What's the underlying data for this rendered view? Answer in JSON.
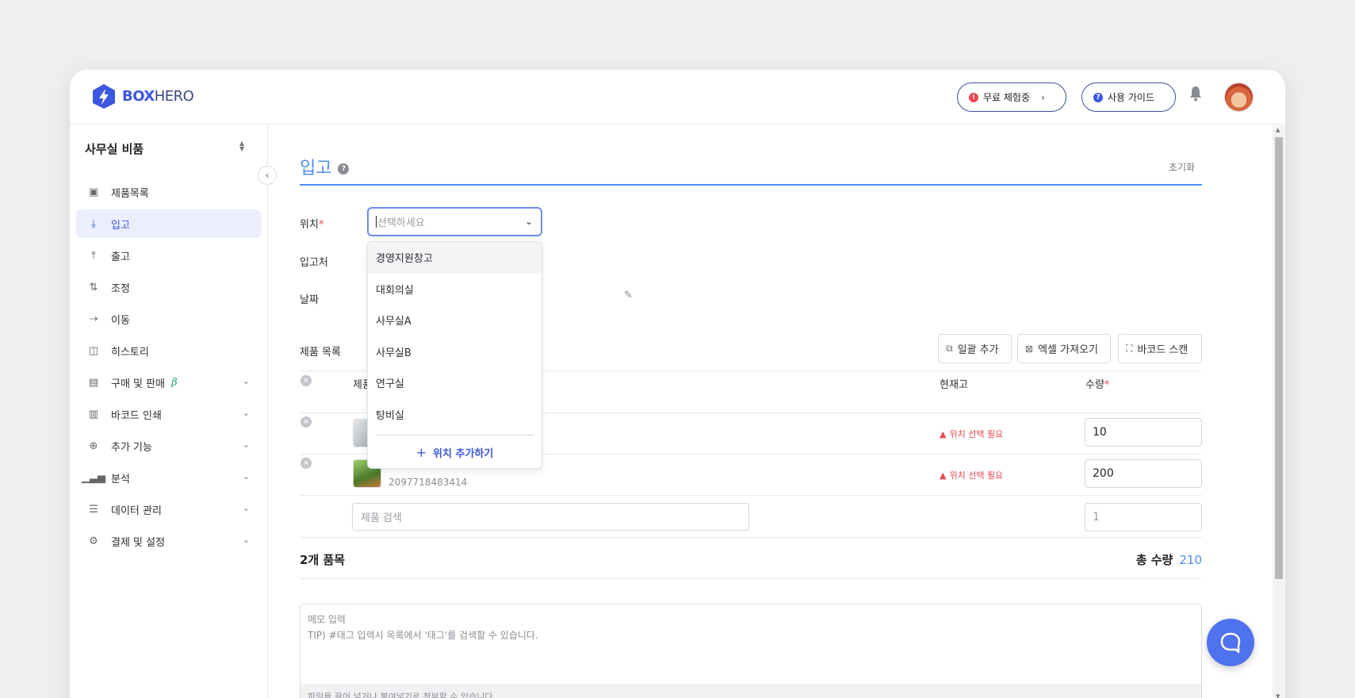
{
  "header": {
    "logo_text_bold": "BOX",
    "logo_text_rest": "HERO",
    "trial_label": "무료 체험중",
    "trial_badge": "!",
    "guide_label": "사용 가이드",
    "guide_badge": "?"
  },
  "sidebar": {
    "workspace": "사무실 비품",
    "items": [
      {
        "label": "제품목록",
        "icon": "box-icon"
      },
      {
        "label": "입고",
        "icon": "arrow-down-icon"
      },
      {
        "label": "출고",
        "icon": "arrow-up-icon"
      },
      {
        "label": "조정",
        "icon": "swap-vertical-icon"
      },
      {
        "label": "이동",
        "icon": "arrow-right-icon"
      },
      {
        "label": "히스토리",
        "icon": "history-icon"
      },
      {
        "label": "구매 및 판매",
        "icon": "document-icon",
        "badge": "β"
      },
      {
        "label": "바코드 인쇄",
        "icon": "barcode-icon"
      },
      {
        "label": "추가 기능",
        "icon": "plus-circle-icon"
      },
      {
        "label": "분석",
        "icon": "bar-chart-icon"
      },
      {
        "label": "데이터 관리",
        "icon": "database-icon"
      },
      {
        "label": "결제 및 설정",
        "icon": "gear-icon"
      }
    ]
  },
  "main": {
    "title": "입고",
    "help_badge": "?",
    "reset_label": "초기화",
    "location_label": "위치",
    "required_mark": "*",
    "location_placeholder": "선택하세요",
    "supplier_label": "입고처",
    "date_label": "날짜",
    "dropdown": {
      "options": [
        "경영지원창고",
        "대회의실",
        "사무실A",
        "사무실B",
        "연구실",
        "탕비실"
      ],
      "add_label": "위치 추가하기"
    },
    "products_label": "제품 목록",
    "toolbar": {
      "bulk_add": "일괄 추가",
      "excel_import": "엑셀 가져오기",
      "barcode_scan": "바코드 스캔"
    },
    "table": {
      "col_product": "제품",
      "col_stock": "현재고",
      "col_qty": "수량",
      "rows": [
        {
          "barcode": "",
          "warning": "위치 선택 필요",
          "qty": "10"
        },
        {
          "barcode": "2097718483414",
          "warning": "위치 선택 필요",
          "qty": "200"
        }
      ],
      "search_placeholder": "제품 검색",
      "qty_placeholder": "1"
    },
    "summary": {
      "count": "2개 품목",
      "total_label": "총 수량",
      "total_value": "210"
    },
    "memo": {
      "placeholder_line1": "메모 입력",
      "placeholder_line2": "TIP) #태그 입력시 목록에서 '태그'를 검색할 수 있습니다.",
      "drop_hint": "파일을 끌어 넣거나 붙여넣기로 첨부할 수 있습니다."
    }
  },
  "colors": {
    "accent": "#4f8df2",
    "brand": "#3b56e0",
    "danger": "#e8474f"
  }
}
